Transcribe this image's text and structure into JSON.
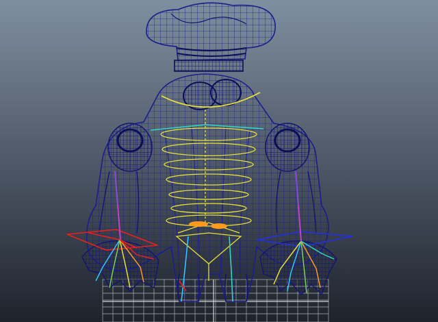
{
  "viewport": {
    "background_top": "#7f8fa0",
    "background_bottom": "#1e232b",
    "wire_color": "#1a1f8a",
    "grid_color": "#d0d0d0",
    "rig_colors": {
      "spine": "#e8e23a",
      "clavicle": "#2fd6c4",
      "left_hand_control": "#e82020",
      "right_hand_control": "#2430e0",
      "hip_joints": "#ff9a1a",
      "finger_joints": "#33c7ff"
    },
    "icons": [
      "character-wireframe",
      "chef-hat-icon",
      "control-curve",
      "ground-grid"
    ]
  }
}
